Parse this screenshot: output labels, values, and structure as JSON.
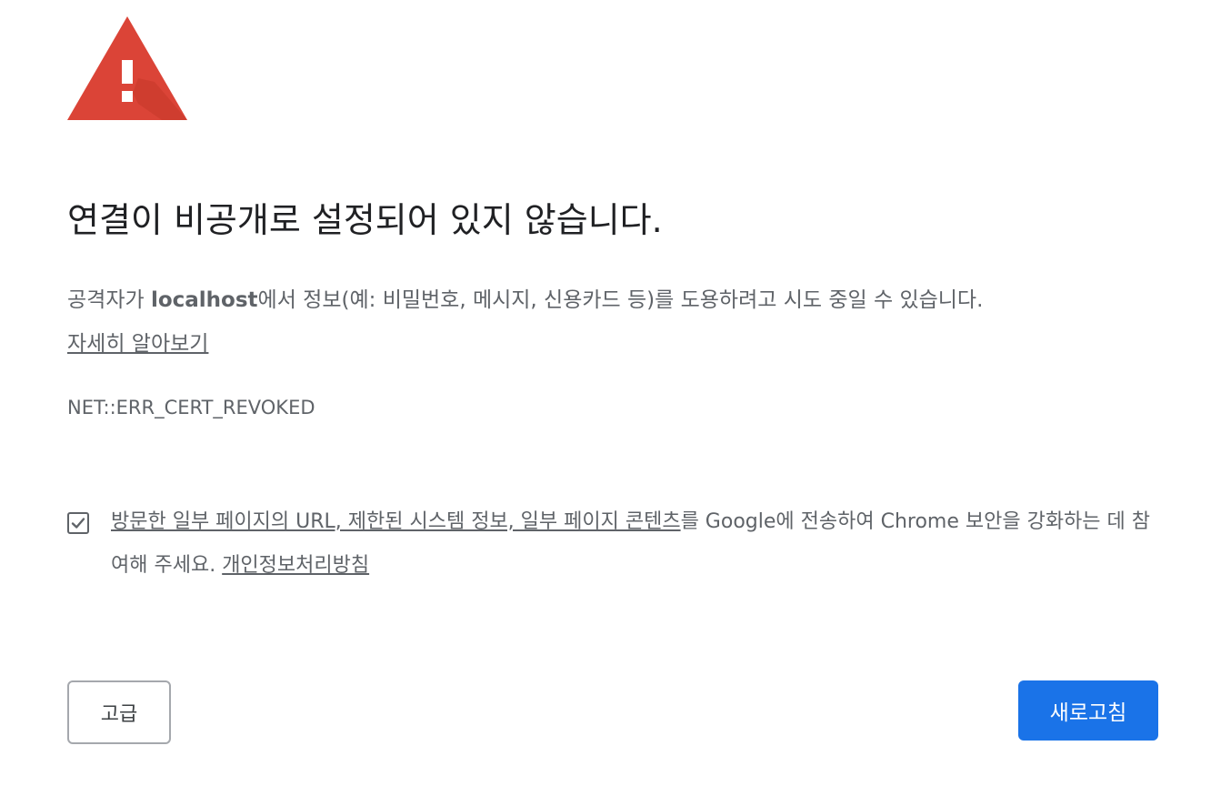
{
  "icon": {
    "name": "warning-triangle-icon",
    "color": "#db4437"
  },
  "heading": "연결이 비공개로 설정되어 있지 않습니다.",
  "explanation": {
    "prefix": "공격자가 ",
    "host": "localhost",
    "suffix": "에서 정보(예: 비밀번호, 메시지, 신용카드 등)를 도용하려고 시도 중일 수 있습니다.",
    "learn_more": "자세히 알아보기"
  },
  "error_code": "NET::ERR_CERT_REVOKED",
  "optin": {
    "checked": true,
    "link_text": "방문한 일부 페이지의 URL, 제한된 시스템 정보, 일부 페이지 콘텐츠",
    "text_after": "를 Google에 전송하여 Chrome 보안을 강화하는 데 참여해 주세요. ",
    "privacy_link": "개인정보처리방침"
  },
  "buttons": {
    "advanced_label": "고급",
    "reload_label": "새로고침"
  },
  "colors": {
    "accent": "#1a73e8",
    "warning": "#db4437",
    "text_secondary": "#5f6368"
  }
}
